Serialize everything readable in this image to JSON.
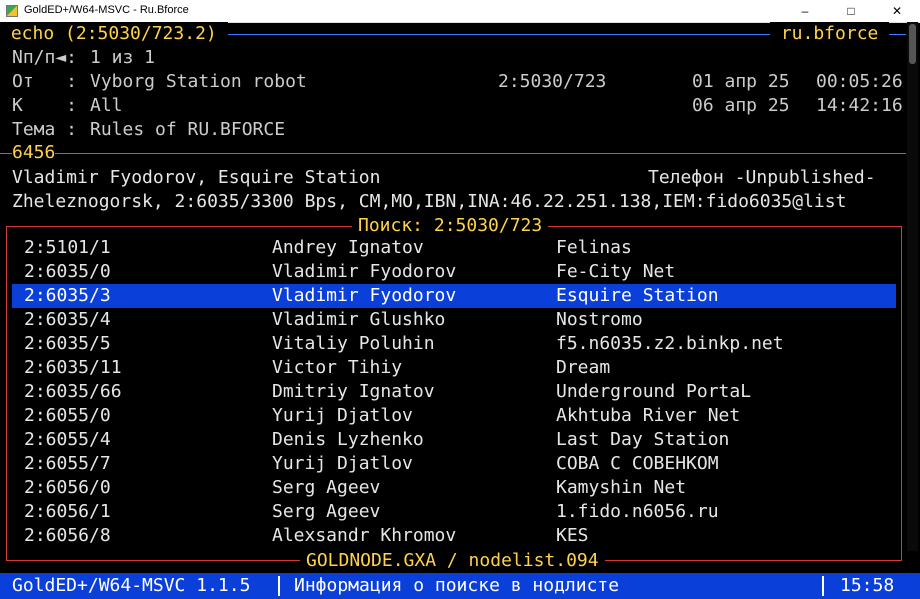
{
  "window": {
    "title": "GoldED+/W64-MSVC - Ru.Bforce",
    "minimize": "–",
    "maximize": "□",
    "close": "✕"
  },
  "header": {
    "echo": " echo (2:5030/723.2) ",
    "area": " ru.bforce ",
    "msgnum_label": "Nп/п◄:",
    "msgnum_value": "1 из 1",
    "from_label": "От   :",
    "from_name": "Vyborg Station robot",
    "from_addr": "2:5030/723",
    "from_date": "01 апр 25",
    "from_time": "00:05:26",
    "to_label": "К    :",
    "to_name": "All",
    "to_date": "06 апр 25",
    "to_time": "14:42:16",
    "subj_label": "Тема :",
    "subj_value": "Rules of RU.BFORCE",
    "msg_size": "6456"
  },
  "node_info": {
    "line1_name": "Vladimir Fyodorov, Esquire Station",
    "line1_phone": "Телефон -Unpublished-",
    "line2": "Zheleznogorsk, 2:6035/3300 Bps, CM,MO,IBN,INA:46.22.251.138,IEM:fido6035@list"
  },
  "search": {
    "title": "Поиск: 2:5030/723",
    "footer": "GOLDNODE.GXA / nodelist.094",
    "selected_index": 2,
    "rows": [
      {
        "addr": "2:5101/1",
        "sysop": "Andrey Ignatov",
        "system": "Felinas"
      },
      {
        "addr": "2:6035/0",
        "sysop": "Vladimir Fyodorov",
        "system": "Fe-City Net"
      },
      {
        "addr": "2:6035/3",
        "sysop": "Vladimir Fyodorov",
        "system": "Esquire Station"
      },
      {
        "addr": "2:6035/4",
        "sysop": "Vladimir Glushko",
        "system": "Nostromo"
      },
      {
        "addr": "2:6035/5",
        "sysop": "Vitaliy Poluhin",
        "system": "f5.n6035.z2.binkp.net"
      },
      {
        "addr": "2:6035/11",
        "sysop": "Victor Tihiy",
        "system": "Dream"
      },
      {
        "addr": "2:6035/66",
        "sysop": "Dmitriy Ignatov",
        "system": "Underground PortaL"
      },
      {
        "addr": "2:6055/0",
        "sysop": "Yurij Djatlov",
        "system": "Akhtuba River Net"
      },
      {
        "addr": "2:6055/4",
        "sysop": "Denis Lyzhenko",
        "system": "Last Day Station"
      },
      {
        "addr": "2:6055/7",
        "sysop": "Yurij Djatlov",
        "system": "СОВА С СОВЕНКОМ"
      },
      {
        "addr": "2:6056/0",
        "sysop": "Serg Ageev",
        "system": "Kamyshin Net"
      },
      {
        "addr": "2:6056/1",
        "sysop": "Serg Ageev",
        "system": "1.fido.n6056.ru"
      },
      {
        "addr": "2:6056/8",
        "sysop": "Alexsandr Khromov",
        "system": "KES"
      }
    ]
  },
  "status": {
    "version": "GoldED+/W64-MSVC 1.1.5",
    "message": "Информация о поиске в нодлисте",
    "clock": "15:58"
  },
  "colors": {
    "accent_blue": "#0b3fd9",
    "label_yellow": "#ffd24a",
    "frame_red": "#d23a3a",
    "rule_blue": "#3a7bff"
  }
}
